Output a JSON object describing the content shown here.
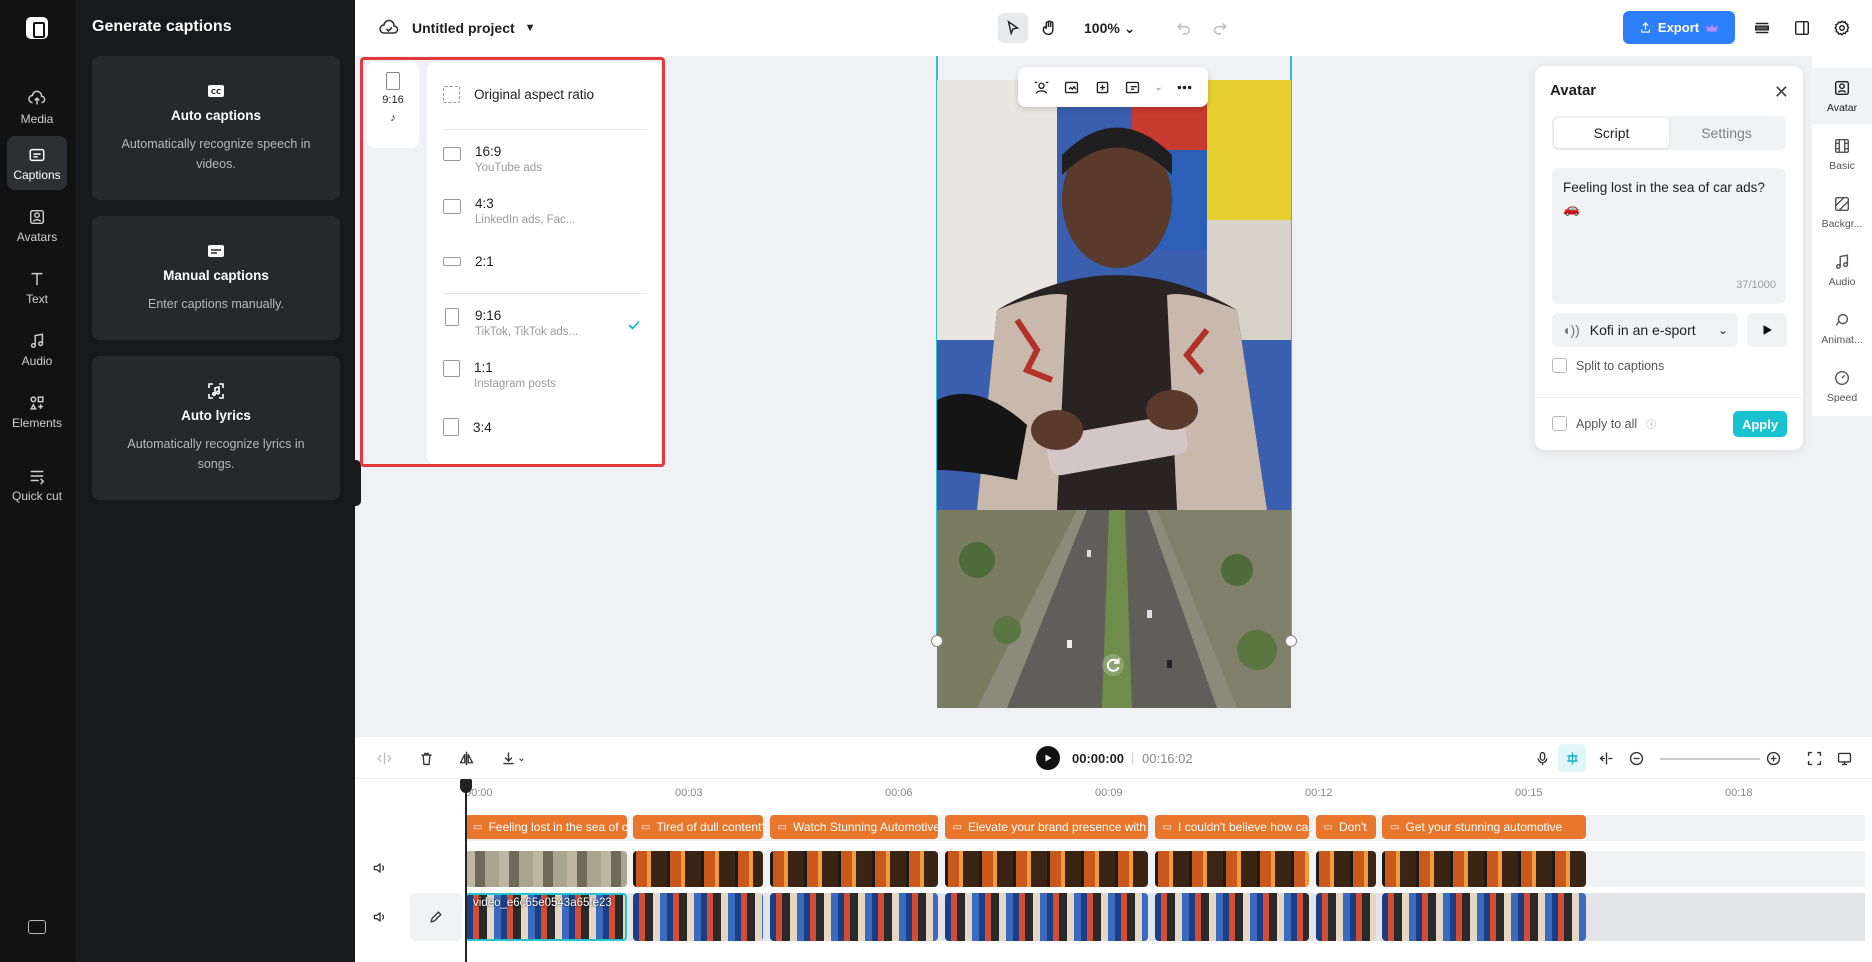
{
  "rail": {
    "items": [
      {
        "label": "Media",
        "icon": "cloud-upload-icon"
      },
      {
        "label": "Captions",
        "icon": "captions-icon"
      },
      {
        "label": "Avatars",
        "icon": "avatar-icon"
      },
      {
        "label": "Text",
        "icon": "text-icon"
      },
      {
        "label": "Audio",
        "icon": "music-note-icon"
      },
      {
        "label": "Elements",
        "icon": "elements-icon"
      },
      {
        "label": "Quick cut",
        "icon": "quick-cut-icon"
      }
    ],
    "active": "Captions"
  },
  "captions_panel": {
    "title": "Generate captions",
    "cards": [
      {
        "title": "Auto captions",
        "desc": "Automatically recognize speech in videos.",
        "icon": "cc-icon"
      },
      {
        "title": "Manual captions",
        "desc": "Enter captions manually.",
        "icon": "subtitle-icon"
      },
      {
        "title": "Auto lyrics",
        "desc": "Automatically recognize lyrics in songs.",
        "icon": "lyrics-icon"
      }
    ]
  },
  "topbar": {
    "project_title": "Untitled project",
    "zoom": "100%",
    "export_label": "Export"
  },
  "aspect": {
    "current": "9:16",
    "options": [
      {
        "label": "Original aspect ratio",
        "sub": ""
      },
      {
        "label": "16:9",
        "sub": "YouTube ads"
      },
      {
        "label": "4:3",
        "sub": "LinkedIn ads, Fac..."
      },
      {
        "label": "2:1",
        "sub": ""
      },
      {
        "label": "9:16",
        "sub": "TikTok, TikTok ads..."
      },
      {
        "label": "1:1",
        "sub": "Instagram posts"
      },
      {
        "label": "3:4",
        "sub": ""
      }
    ],
    "selected": "9:16"
  },
  "avatar_panel": {
    "title": "Avatar",
    "tabs": [
      "Script",
      "Settings"
    ],
    "active_tab": "Script",
    "script_text": "Feeling lost in the sea of car ads?🚗",
    "char_count": "37/1000",
    "voice": "Kofi in an e-sport",
    "split_label": "Split to captions",
    "apply_all_label": "Apply to all",
    "apply_label": "Apply"
  },
  "props": [
    {
      "label": "Avatar",
      "icon": "avatar-icon"
    },
    {
      "label": "Basic",
      "icon": "film-icon"
    },
    {
      "label": "Backgr...",
      "icon": "background-icon"
    },
    {
      "label": "Audio",
      "icon": "music-note-icon"
    },
    {
      "label": "Animat...",
      "icon": "animation-icon"
    },
    {
      "label": "Speed",
      "icon": "speed-icon"
    }
  ],
  "timeline": {
    "current_time": "00:00:00",
    "duration": "00:16:02",
    "ruler": [
      "00:00",
      "00:03",
      "00:06",
      "00:09",
      "00:12",
      "00:15",
      "00:18"
    ],
    "captions": [
      {
        "text": "Feeling lost in the sea of car ads?",
        "start": 0.0,
        "end": 2.35
      },
      {
        "text": "Tired of dull content?",
        "start": 2.4,
        "end": 4.3
      },
      {
        "text": "Watch Stunning Automotive",
        "start": 4.35,
        "end": 6.8
      },
      {
        "text": "Elevate your brand presence with",
        "start": 6.85,
        "end": 9.8
      },
      {
        "text": "I couldn't believe how car",
        "start": 9.85,
        "end": 12.1
      },
      {
        "text": "Don't",
        "start": 12.15,
        "end": 13.05
      },
      {
        "text": "Get your stunning automotive",
        "start": 13.1,
        "end": 16.05
      }
    ],
    "video_clip_name": "video_e6c65e0543a65fe23"
  },
  "colors": {
    "accent": "#2d7ff9",
    "selection": "#25c2d0",
    "caption_clip": "#e8762c",
    "highlight": "#e3393c"
  }
}
